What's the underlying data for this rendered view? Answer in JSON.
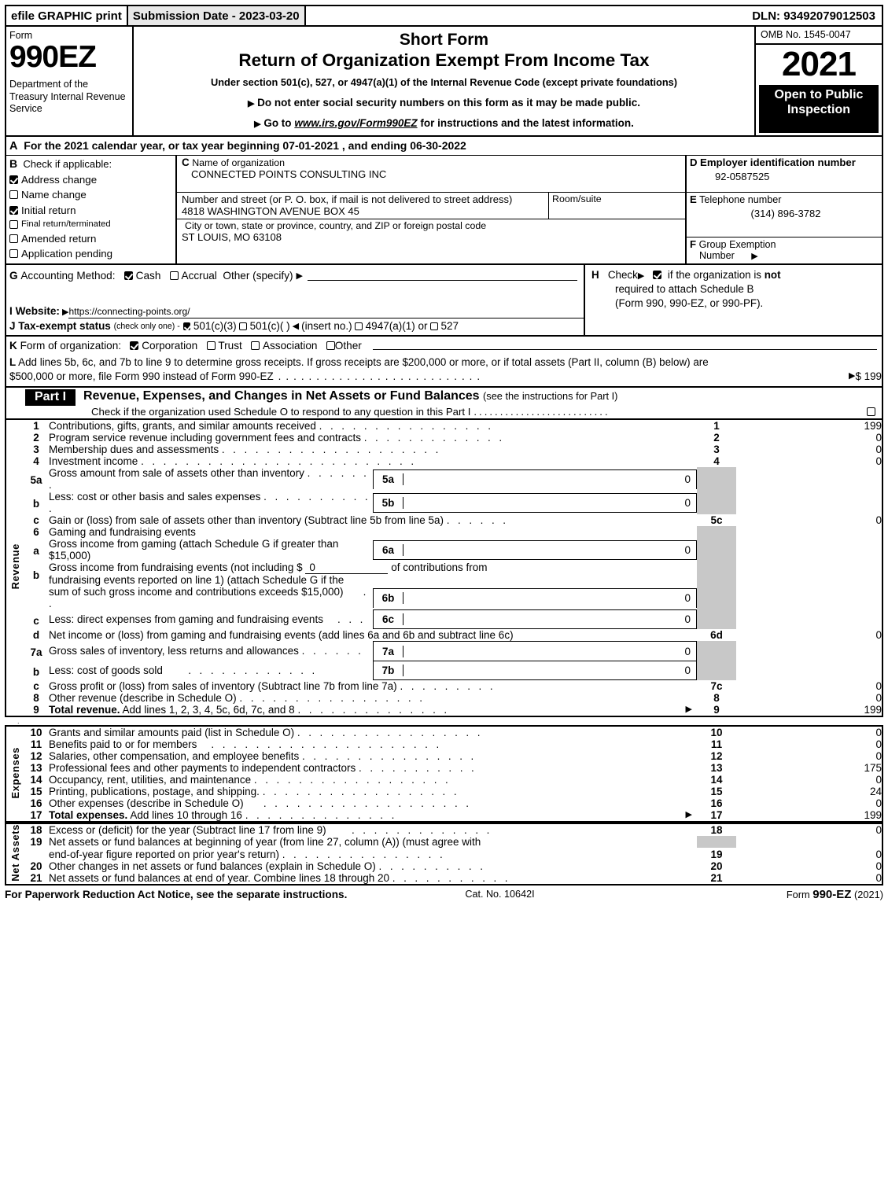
{
  "efile": {
    "graphic_label": "efile GRAPHIC print",
    "submission_label": "Submission Date - 2023-03-20",
    "dln": "DLN: 93492079012503"
  },
  "masthead": {
    "form_label": "Form",
    "form_number": "990EZ",
    "department": "Department of the Treasury Internal Revenue Service",
    "title_line1": "Short Form",
    "title_line2": "Return of Organization Exempt From Income Tax",
    "subtitle": "Under section 501(c), 527, or 4947(a)(1) of the Internal Revenue Code (except private foundations)",
    "bullet1": "Do not enter social security numbers on this form as it may be made public.",
    "bullet2_pre": "Go to",
    "bullet2_link": "www.irs.gov/Form990EZ",
    "bullet2_post": "for instructions and the latest information.",
    "omb": "OMB No. 1545-0047",
    "year": "2021",
    "open_to_public": "Open to Public Inspection"
  },
  "section_a": {
    "letter": "A",
    "text": "For the 2021 calendar year, or tax year beginning 07-01-2021 , and ending 06-30-2022"
  },
  "section_b": {
    "letter": "B",
    "header": "Check if applicable:",
    "items": [
      {
        "label": "Address change",
        "checked": true
      },
      {
        "label": "Name change",
        "checked": false
      },
      {
        "label": "Initial return",
        "checked": true
      },
      {
        "label": "Final return/terminated",
        "checked": false
      },
      {
        "label": "Amended return",
        "checked": false
      },
      {
        "label": "Application pending",
        "checked": false
      }
    ]
  },
  "section_c": {
    "letter": "C",
    "name_caption": "Name of organization",
    "name_value": "CONNECTED POINTS CONSULTING INC",
    "street_caption": "Number and street (or P. O. box, if mail is not delivered to street address)",
    "street_value": "4818 WASHINGTON AVENUE BOX 45",
    "room_caption": "Room/suite",
    "room_value": "",
    "city_caption": "City or town, state or province, country, and ZIP or foreign postal code",
    "city_value": "ST LOUIS, MO   63108"
  },
  "section_d": {
    "letter": "D",
    "ein_caption": "Employer identification number",
    "ein_value": "92-0587525",
    "letter_e": "E",
    "phone_caption": "Telephone number",
    "phone_value": "(314) 896-3782",
    "letter_f": "F",
    "group_caption_1": "Group Exemption",
    "group_caption_2": "Number"
  },
  "section_g": {
    "letter": "G",
    "label": "Accounting Method:",
    "cash": "Cash",
    "cash_checked": true,
    "accrual": "Accrual",
    "accrual_checked": false,
    "other": "Other (specify)"
  },
  "section_h": {
    "letter": "H",
    "check_label": "Check",
    "checked": true,
    "text_a": "if the organization is",
    "text_b": "not",
    "line2": "required to attach Schedule B",
    "line3": "(Form 990, 990-EZ, or 990-PF)."
  },
  "section_i": {
    "letter": "I",
    "label": "Website:",
    "url": "https://connecting-points.org/"
  },
  "section_j": {
    "letter": "J",
    "label": "Tax-exempt status",
    "note": "(check only one) -",
    "opt1": "501(c)(3)",
    "opt1_checked": true,
    "opt2": "501(c)(    )",
    "opt2_checked": false,
    "insert": "(insert no.)",
    "opt3": "4947(a)(1) or",
    "opt3_checked": false,
    "opt4": "527",
    "opt4_checked": false
  },
  "section_k": {
    "letter": "K",
    "label": "Form of organization:",
    "options": [
      {
        "label": "Corporation",
        "checked": true
      },
      {
        "label": "Trust",
        "checked": false
      },
      {
        "label": "Association",
        "checked": false
      },
      {
        "label": "Other",
        "checked": false
      }
    ]
  },
  "section_l": {
    "letter": "L",
    "line1": "Add lines 5b, 6c, and 7b to line 9 to determine gross receipts. If gross receipts are $200,000 or more, or if total assets (Part II, column (B) below) are",
    "line2": "$500,000 or more, file Form 990 instead of Form 990-EZ",
    "amount": "$ 199"
  },
  "part1": {
    "badge": "Part I",
    "title": "Revenue, Expenses, and Changes in Net Assets or Fund Balances",
    "title_note": "(see the instructions for Part I)",
    "subtitle": "Check if the organization used Schedule O to respond to any question in this Part I",
    "schedule_o_checked": false,
    "revenue_label": "Revenue",
    "expenses_label": "Expenses",
    "net_assets_label": "Net Assets"
  },
  "rows": [
    {
      "num": "1",
      "desc": "Contributions, gifts, grants, and similar amounts received",
      "dots": true,
      "code": "1",
      "amount": "199"
    },
    {
      "num": "2",
      "desc": "Program service revenue including government fees and contracts",
      "dots": true,
      "code": "2",
      "amount": "0"
    },
    {
      "num": "3",
      "desc": "Membership dues and assessments",
      "dots": true,
      "code": "3",
      "amount": "0"
    },
    {
      "num": "4",
      "desc": "Investment income",
      "dots": true,
      "code": "4",
      "amount": "0"
    },
    {
      "num": "5a",
      "desc": "Gross amount from sale of assets other than inventory",
      "sub_code": "5a",
      "sub_value": "0"
    },
    {
      "num": "b",
      "desc": "Less: cost or other basis and sales expenses",
      "sub_code": "5b",
      "sub_value": "0"
    },
    {
      "num": "c",
      "desc": "Gain or (loss) from sale of assets other than inventory (Subtract line 5b from line 5a)",
      "dots": true,
      "code": "5c",
      "amount": "0"
    },
    {
      "num": "6",
      "desc": "Gaming and fundraising events"
    },
    {
      "num": "a",
      "desc": "Gross income from gaming (attach Schedule G if greater than $15,000)",
      "sub_code": "6a",
      "sub_value": "0"
    },
    {
      "num": "b",
      "desc": "Gross income from fundraising events (not including $",
      "inline_value": "0",
      "desc2": "of contributions from",
      "desc3": "fundraising events reported on line 1) (attach Schedule G if the"
    },
    {
      "num": "",
      "desc": "sum of such gross income and contributions exceeds $15,000)",
      "sub_code": "6b",
      "sub_value": "0"
    },
    {
      "num": "c",
      "desc": "Less: direct expenses from gaming and fundraising events",
      "sub_code": "6c",
      "sub_value": "0"
    },
    {
      "num": "d",
      "desc": "Net income or (loss) from gaming and fundraising events (add lines 6a and 6b and subtract line 6c)",
      "code": "6d",
      "amount": "0"
    },
    {
      "num": "7a",
      "desc": "Gross sales of inventory, less returns and allowances",
      "sub_code": "7a",
      "sub_value": "0"
    },
    {
      "num": "b",
      "desc": "Less: cost of goods sold",
      "sub_code": "7b",
      "sub_value": "0"
    },
    {
      "num": "c",
      "desc": "Gross profit or (loss) from sales of inventory (Subtract line 7b from line 7a)",
      "dots": true,
      "code": "7c",
      "amount": "0"
    },
    {
      "num": "8",
      "desc": "Other revenue (describe in Schedule O)",
      "dots": true,
      "code": "8",
      "amount": "0"
    },
    {
      "num": "9",
      "desc_bold": "Total revenue.",
      "desc": "Add lines 1, 2, 3, 4, 5c, 6d, 7c, and 8",
      "dots": true,
      "arrow": true,
      "code": "9",
      "amount": "199"
    }
  ],
  "expense_rows": [
    {
      "num": "10",
      "desc": "Grants and similar amounts paid (list in Schedule O)",
      "dots": true,
      "code": "10",
      "amount": "0"
    },
    {
      "num": "11",
      "desc": "Benefits paid to or for members",
      "dots": true,
      "code": "11",
      "amount": "0"
    },
    {
      "num": "12",
      "desc": "Salaries, other compensation, and employee benefits",
      "dots": true,
      "code": "12",
      "amount": "0"
    },
    {
      "num": "13",
      "desc": "Professional fees and other payments to independent contractors",
      "dots": true,
      "code": "13",
      "amount": "175"
    },
    {
      "num": "14",
      "desc": "Occupancy, rent, utilities, and maintenance",
      "dots": true,
      "code": "14",
      "amount": "0"
    },
    {
      "num": "15",
      "desc": "Printing, publications, postage, and shipping.",
      "dots": true,
      "code": "15",
      "amount": "24"
    },
    {
      "num": "16",
      "desc": "Other expenses (describe in Schedule O)",
      "dots": true,
      "code": "16",
      "amount": "0"
    },
    {
      "num": "17",
      "desc_bold": "Total expenses.",
      "desc": "Add lines 10 through 16",
      "dots": true,
      "arrow": true,
      "code": "17",
      "amount": "199"
    }
  ],
  "net_rows": [
    {
      "num": "18",
      "desc": "Excess or (deficit) for the year (Subtract line 17 from line 9)",
      "dots": true,
      "code": "18",
      "amount": "0"
    },
    {
      "num": "19",
      "desc": "Net assets or fund balances at beginning of year (from line 27, column (A)) (must agree with",
      "gray": true
    },
    {
      "num": "",
      "desc": "end-of-year figure reported on prior year's return)",
      "dots": true,
      "code": "19",
      "amount": "0"
    },
    {
      "num": "20",
      "desc": "Other changes in net assets or fund balances (explain in Schedule O)",
      "dots": true,
      "code": "20",
      "amount": "0"
    },
    {
      "num": "21",
      "desc": "Net assets or fund balances at end of year. Combine lines 18 through 20",
      "dots": true,
      "code": "21",
      "amount": "0"
    }
  ],
  "footer": {
    "notice": "For Paperwork Reduction Act Notice, see the separate instructions.",
    "cat": "Cat. No. 10642I",
    "form_pre": "Form",
    "form_name": "990-EZ",
    "form_year": "(2021)"
  }
}
